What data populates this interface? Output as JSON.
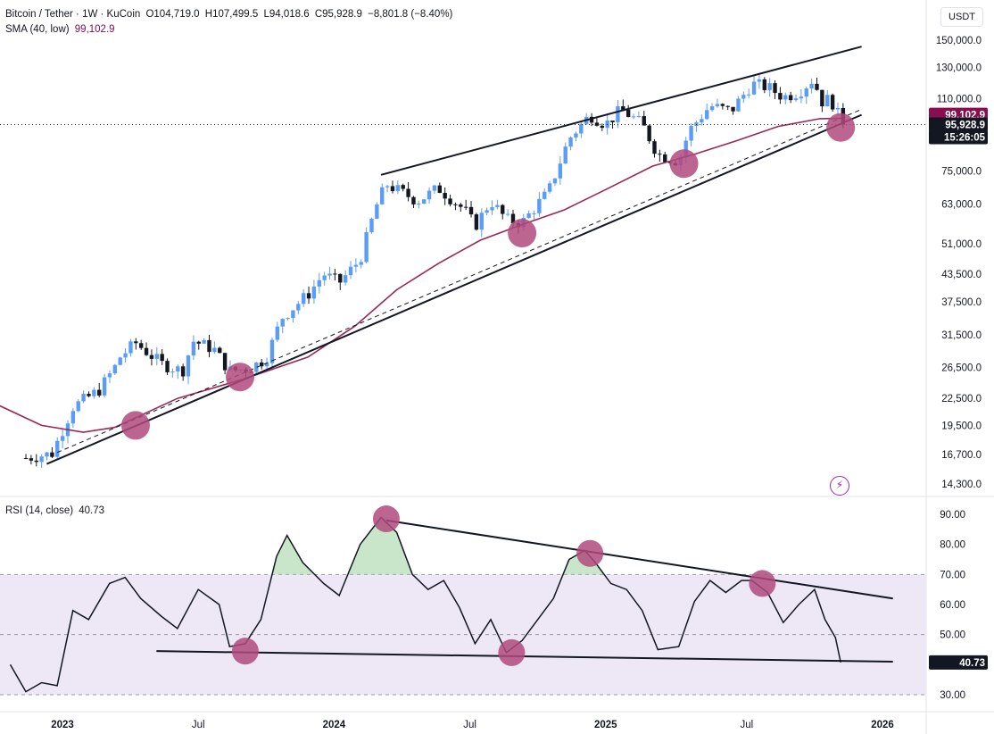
{
  "header": {
    "symbol": "Bitcoin / Tether · 1W · KuCoin",
    "open": "O104,719.0",
    "high": "H107,499.5",
    "low": "L94,018.6",
    "close": "C95,928.9",
    "change": "−8,801.8 (−8.40%)",
    "sma_label": "SMA (40, low)",
    "sma_value": "99,102.9",
    "rsi_label": "RSI (14, close)",
    "rsi_value": "40.73",
    "currency": "USDT"
  },
  "price_axis": {
    "ticks": [
      "150,000.0",
      "130,000.0",
      "110,000.0",
      "75,000.0",
      "63,000.0",
      "51,000.0",
      "43,500.0",
      "37,500.0",
      "31,500.0",
      "26,500.0",
      "22,500.0",
      "19,500.0",
      "16,700.0",
      "14,300.0"
    ],
    "sma_tag": "99,102.9",
    "price_tag": "95,928.9",
    "countdown_tag": "15:26:05"
  },
  "rsi_axis": {
    "ticks": [
      "90.00",
      "80.00",
      "70.00",
      "60.00",
      "50.00",
      "40.00",
      "30.00"
    ],
    "value_tag": "40.73"
  },
  "time_axis": {
    "ticks": [
      "2023",
      "Jul",
      "2024",
      "Jul",
      "2025",
      "Jul",
      "2026"
    ]
  },
  "colors": {
    "up": "#5b9cf6",
    "down": "#131722",
    "sma": "#9c2756",
    "trendline": "#131722",
    "marker": "#b04a7d",
    "rsi_band": "#ede7f6",
    "rsi_overbought_fill": "#a5d6a7"
  },
  "chart_data": {
    "type": "candlestick",
    "symbol": "Bitcoin / Tether",
    "interval": "1W",
    "exchange": "KuCoin",
    "last_candle": {
      "open": 104719.0,
      "high": 107499.5,
      "low": 94018.6,
      "close": 95928.9,
      "change": -8801.8,
      "change_pct": -8.4
    },
    "price_scale": "log",
    "ylim": [
      13500,
      165000
    ],
    "close_path": [
      [
        "2022-11-14",
        16400
      ],
      [
        "2022-12-19",
        16800
      ],
      [
        "2023-01-16",
        21500
      ],
      [
        "2023-02-20",
        23500
      ],
      [
        "2023-03-13",
        26500
      ],
      [
        "2023-03-20",
        28000
      ],
      [
        "2023-04-10",
        30200
      ],
      [
        "2023-05-15",
        27000
      ],
      [
        "2023-06-12",
        26000
      ],
      [
        "2023-06-26",
        30500
      ],
      [
        "2023-07-24",
        29200
      ],
      [
        "2023-08-14",
        26000
      ],
      [
        "2023-09-11",
        26500
      ],
      [
        "2023-10-02",
        27800
      ],
      [
        "2023-10-23",
        34500
      ],
      [
        "2023-11-27",
        39000
      ],
      [
        "2023-12-18",
        43500
      ],
      [
        "2024-01-08",
        41500
      ],
      [
        "2024-02-05",
        47000
      ],
      [
        "2024-02-26",
        62000
      ],
      [
        "2024-03-11",
        70000
      ],
      [
        "2024-04-22",
        64000
      ],
      [
        "2024-05-20",
        68500
      ],
      [
        "2024-06-24",
        61000
      ],
      [
        "2024-07-08",
        56000
      ],
      [
        "2024-07-29",
        64000
      ],
      [
        "2024-08-19",
        58000
      ],
      [
        "2024-09-09",
        57000
      ],
      [
        "2024-09-30",
        63000
      ],
      [
        "2024-10-14",
        67000
      ],
      [
        "2024-11-11",
        89000
      ],
      [
        "2024-12-09",
        101000
      ],
      [
        "2024-12-30",
        96000
      ],
      [
        "2025-01-20",
        104000
      ],
      [
        "2025-02-17",
        96000
      ],
      [
        "2025-03-10",
        82000
      ],
      [
        "2025-04-07",
        79000
      ],
      [
        "2025-04-21",
        93000
      ],
      [
        "2025-05-19",
        106000
      ],
      [
        "2025-06-16",
        103000
      ],
      [
        "2025-07-14",
        119000
      ],
      [
        "2025-08-04",
        117000
      ],
      [
        "2025-08-25",
        111000
      ],
      [
        "2025-09-15",
        114000
      ],
      [
        "2025-10-06",
        123000
      ],
      [
        "2025-10-13",
        108000
      ],
      [
        "2025-10-27",
        110000
      ],
      [
        "2025-11-03",
        104719
      ],
      [
        "2025-11-10",
        95928.9
      ]
    ],
    "sma": {
      "name": "SMA (40, low)",
      "last": 99102.9,
      "points": [
        [
          "2022-08-01",
          29000
        ],
        [
          "2022-10-01",
          22000
        ],
        [
          "2022-12-05",
          19500
        ],
        [
          "2023-01-30",
          18800
        ],
        [
          "2023-03-13",
          19300
        ],
        [
          "2023-06-05",
          22500
        ],
        [
          "2023-09-04",
          25000
        ],
        [
          "2023-11-27",
          28000
        ],
        [
          "2024-01-29",
          33000
        ],
        [
          "2024-03-25",
          40000
        ],
        [
          "2024-05-20",
          46000
        ],
        [
          "2024-07-15",
          52000
        ],
        [
          "2024-09-09",
          56500
        ],
        [
          "2024-11-04",
          61000
        ],
        [
          "2024-12-30",
          68000
        ],
        [
          "2025-03-03",
          77000
        ],
        [
          "2025-04-28",
          82000
        ],
        [
          "2025-06-23",
          88000
        ],
        [
          "2025-08-18",
          95000
        ],
        [
          "2025-10-13",
          99000
        ],
        [
          "2025-11-10",
          99102.9
        ]
      ]
    },
    "rsi": {
      "name": "RSI (14, close)",
      "last": 40.73,
      "ylim": [
        28,
        95
      ],
      "band": [
        30,
        70
      ],
      "midline": 50,
      "points": [
        [
          "2022-10-24",
          40
        ],
        [
          "2022-11-14",
          31
        ],
        [
          "2022-12-05",
          34
        ],
        [
          "2022-12-26",
          33
        ],
        [
          "2023-01-16",
          58
        ],
        [
          "2023-02-06",
          55
        ],
        [
          "2023-03-06",
          67
        ],
        [
          "2023-03-27",
          69
        ],
        [
          "2023-04-17",
          62
        ],
        [
          "2023-05-15",
          56
        ],
        [
          "2023-06-05",
          52
        ],
        [
          "2023-07-03",
          65
        ],
        [
          "2023-07-31",
          60
        ],
        [
          "2023-08-14",
          46
        ],
        [
          "2023-09-04",
          47
        ],
        [
          "2023-09-25",
          55
        ],
        [
          "2023-10-16",
          76
        ],
        [
          "2023-10-30",
          83
        ],
        [
          "2023-11-20",
          74
        ],
        [
          "2023-12-18",
          67
        ],
        [
          "2024-01-08",
          63
        ],
        [
          "2024-02-05",
          80
        ],
        [
          "2024-03-04",
          89
        ],
        [
          "2024-03-25",
          84
        ],
        [
          "2024-04-15",
          70
        ],
        [
          "2024-05-06",
          65
        ],
        [
          "2024-05-27",
          68
        ],
        [
          "2024-06-17",
          59
        ],
        [
          "2024-07-08",
          47
        ],
        [
          "2024-07-29",
          55
        ],
        [
          "2024-08-19",
          44
        ],
        [
          "2024-09-09",
          48
        ],
        [
          "2024-09-30",
          55
        ],
        [
          "2024-10-21",
          62
        ],
        [
          "2024-11-11",
          75
        ],
        [
          "2024-12-02",
          78
        ],
        [
          "2024-12-16",
          74
        ],
        [
          "2025-01-06",
          67
        ],
        [
          "2025-01-27",
          65
        ],
        [
          "2025-02-17",
          58
        ],
        [
          "2025-03-10",
          45
        ],
        [
          "2025-04-07",
          46
        ],
        [
          "2025-04-28",
          61
        ],
        [
          "2025-05-19",
          68
        ],
        [
          "2025-06-09",
          64
        ],
        [
          "2025-06-30",
          68
        ],
        [
          "2025-07-14",
          68
        ],
        [
          "2025-08-04",
          64
        ],
        [
          "2025-08-25",
          54
        ],
        [
          "2025-09-15",
          60
        ],
        [
          "2025-10-06",
          65
        ],
        [
          "2025-10-20",
          55
        ],
        [
          "2025-11-03",
          49
        ],
        [
          "2025-11-10",
          40.73
        ]
      ]
    },
    "price_trendlines": [
      {
        "from": [
          "2022-12-12",
          15900
        ],
        "to": [
          "2025-12-08",
          101000
        ]
      },
      {
        "from": [
          "2022-12-26",
          16900
        ],
        "to": [
          "2025-12-08",
          104000
        ],
        "dashed": true
      },
      {
        "from": [
          "2024-03-04",
          73500
        ],
        "to": [
          "2025-12-08",
          145000
        ]
      }
    ],
    "rsi_trendlines": [
      {
        "from": [
          "2024-03-11",
          88
        ],
        "to": [
          "2026-01-19",
          62
        ]
      },
      {
        "from": [
          "2023-05-08",
          44.5
        ],
        "to": [
          "2026-01-19",
          41
        ]
      }
    ],
    "price_markers": [
      [
        "2023-04-10",
        19500
      ],
      [
        "2023-08-28",
        25200
      ],
      [
        "2024-09-09",
        54000
      ],
      [
        "2025-04-14",
        78000
      ],
      [
        "2025-11-10",
        94500
      ]
    ],
    "rsi_markers": [
      [
        "2023-09-04",
        44.5
      ],
      [
        "2024-03-11",
        88.5
      ],
      [
        "2024-08-26",
        44
      ],
      [
        "2024-12-09",
        77
      ],
      [
        "2025-07-28",
        67
      ]
    ],
    "x_ticks": [
      "2023",
      "Jul",
      "2024",
      "Jul",
      "2025",
      "Jul",
      "2026"
    ]
  }
}
